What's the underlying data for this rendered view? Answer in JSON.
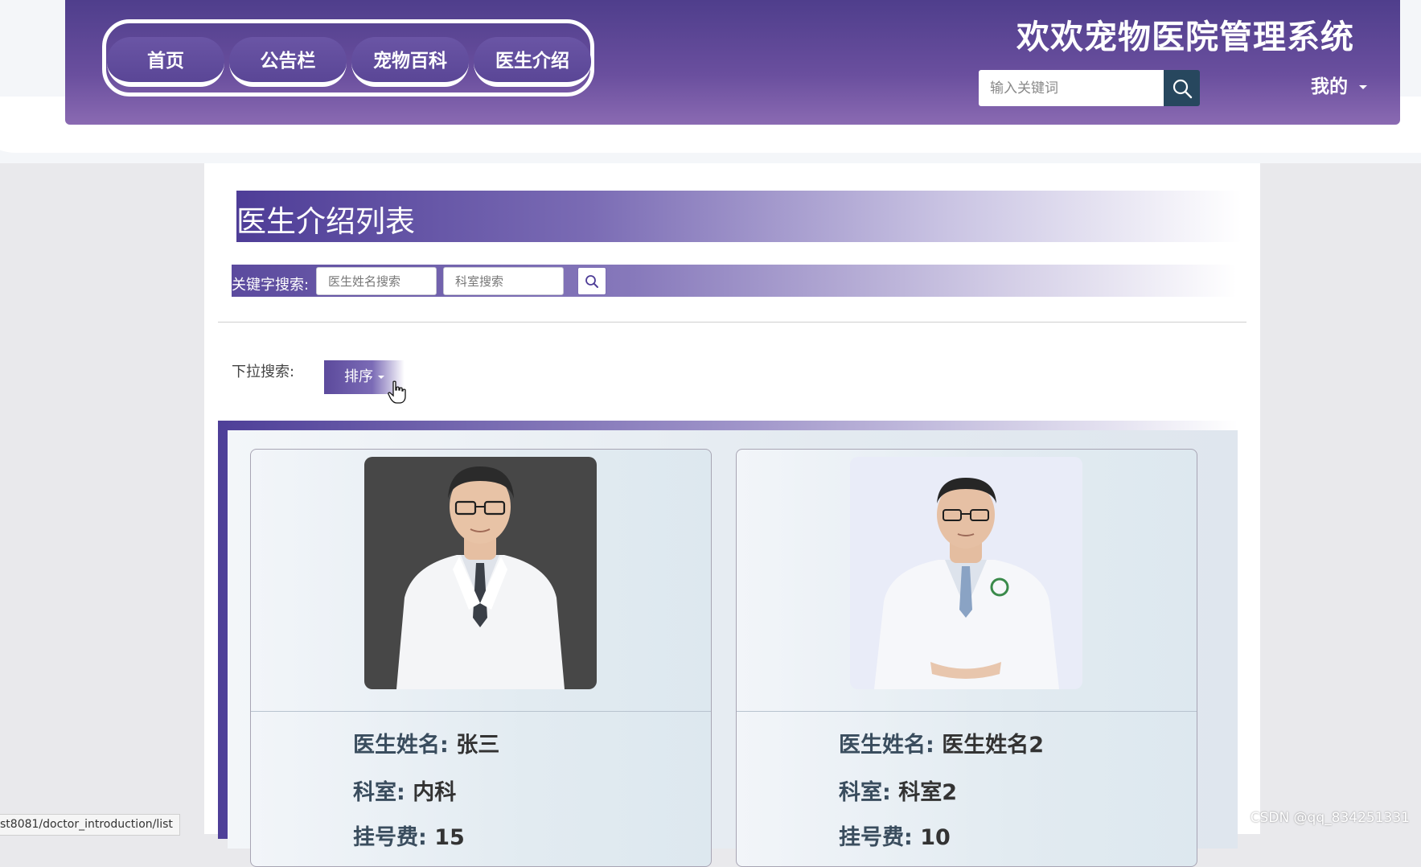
{
  "header": {
    "nav_items": [
      "首页",
      "公告栏",
      "宠物百科",
      "医生介绍"
    ],
    "site_title": "欢欢宠物医院管理系统",
    "search_placeholder": "输入关键词",
    "user_menu": "我的"
  },
  "page": {
    "title": "医生介绍列表",
    "filter_label": "关键字搜索:",
    "name_placeholder": "医生姓名搜索",
    "dept_placeholder": "科室搜索",
    "dropdown_label": "下拉搜索:",
    "sort_label": "排序"
  },
  "doctors": [
    {
      "name_label": "医生姓名:",
      "name": "张三",
      "dept_label": "科室:",
      "dept": "内科",
      "fee_label": "挂号费:",
      "fee": "15"
    },
    {
      "name_label": "医生姓名:",
      "name": "医生姓名2",
      "dept_label": "科室:",
      "dept": "科室2",
      "fee_label": "挂号费:",
      "fee": "10"
    }
  ],
  "status_bar": {
    "url": "st8081/doctor_introduction/list"
  },
  "watermark": "CSDN @qq_834251331",
  "colors": {
    "header": "#5a4696",
    "search_button": "#27475e",
    "accent": "#4e3d97"
  },
  "icons": [
    "search-icon",
    "chevron-down-icon",
    "pointer-cursor-icon"
  ]
}
